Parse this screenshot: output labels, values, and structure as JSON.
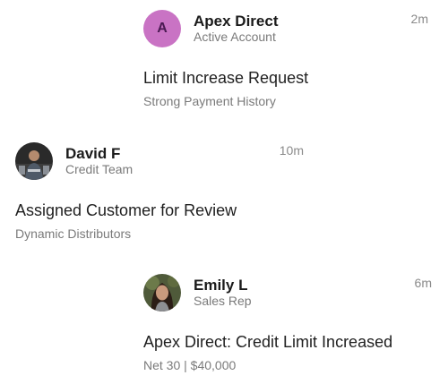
{
  "notifications": [
    {
      "avatar": {
        "type": "letter",
        "letter": "A",
        "color": "#c973c4"
      },
      "name": "Apex Direct",
      "role": "Active Account",
      "time": "2m",
      "title": "Limit Increase Request",
      "subtitle": "Strong Payment History"
    },
    {
      "avatar": {
        "type": "photo"
      },
      "name": "David F",
      "role": "Credit Team",
      "time": "10m",
      "title": "Assigned Customer for Review",
      "subtitle": "Dynamic Distributors"
    },
    {
      "avatar": {
        "type": "photo"
      },
      "name": "Emily L",
      "role": "Sales Rep",
      "time": "6m",
      "title": "Apex Direct: Credit Limit Increased",
      "subtitle": "Net 30 | $40,000"
    }
  ]
}
